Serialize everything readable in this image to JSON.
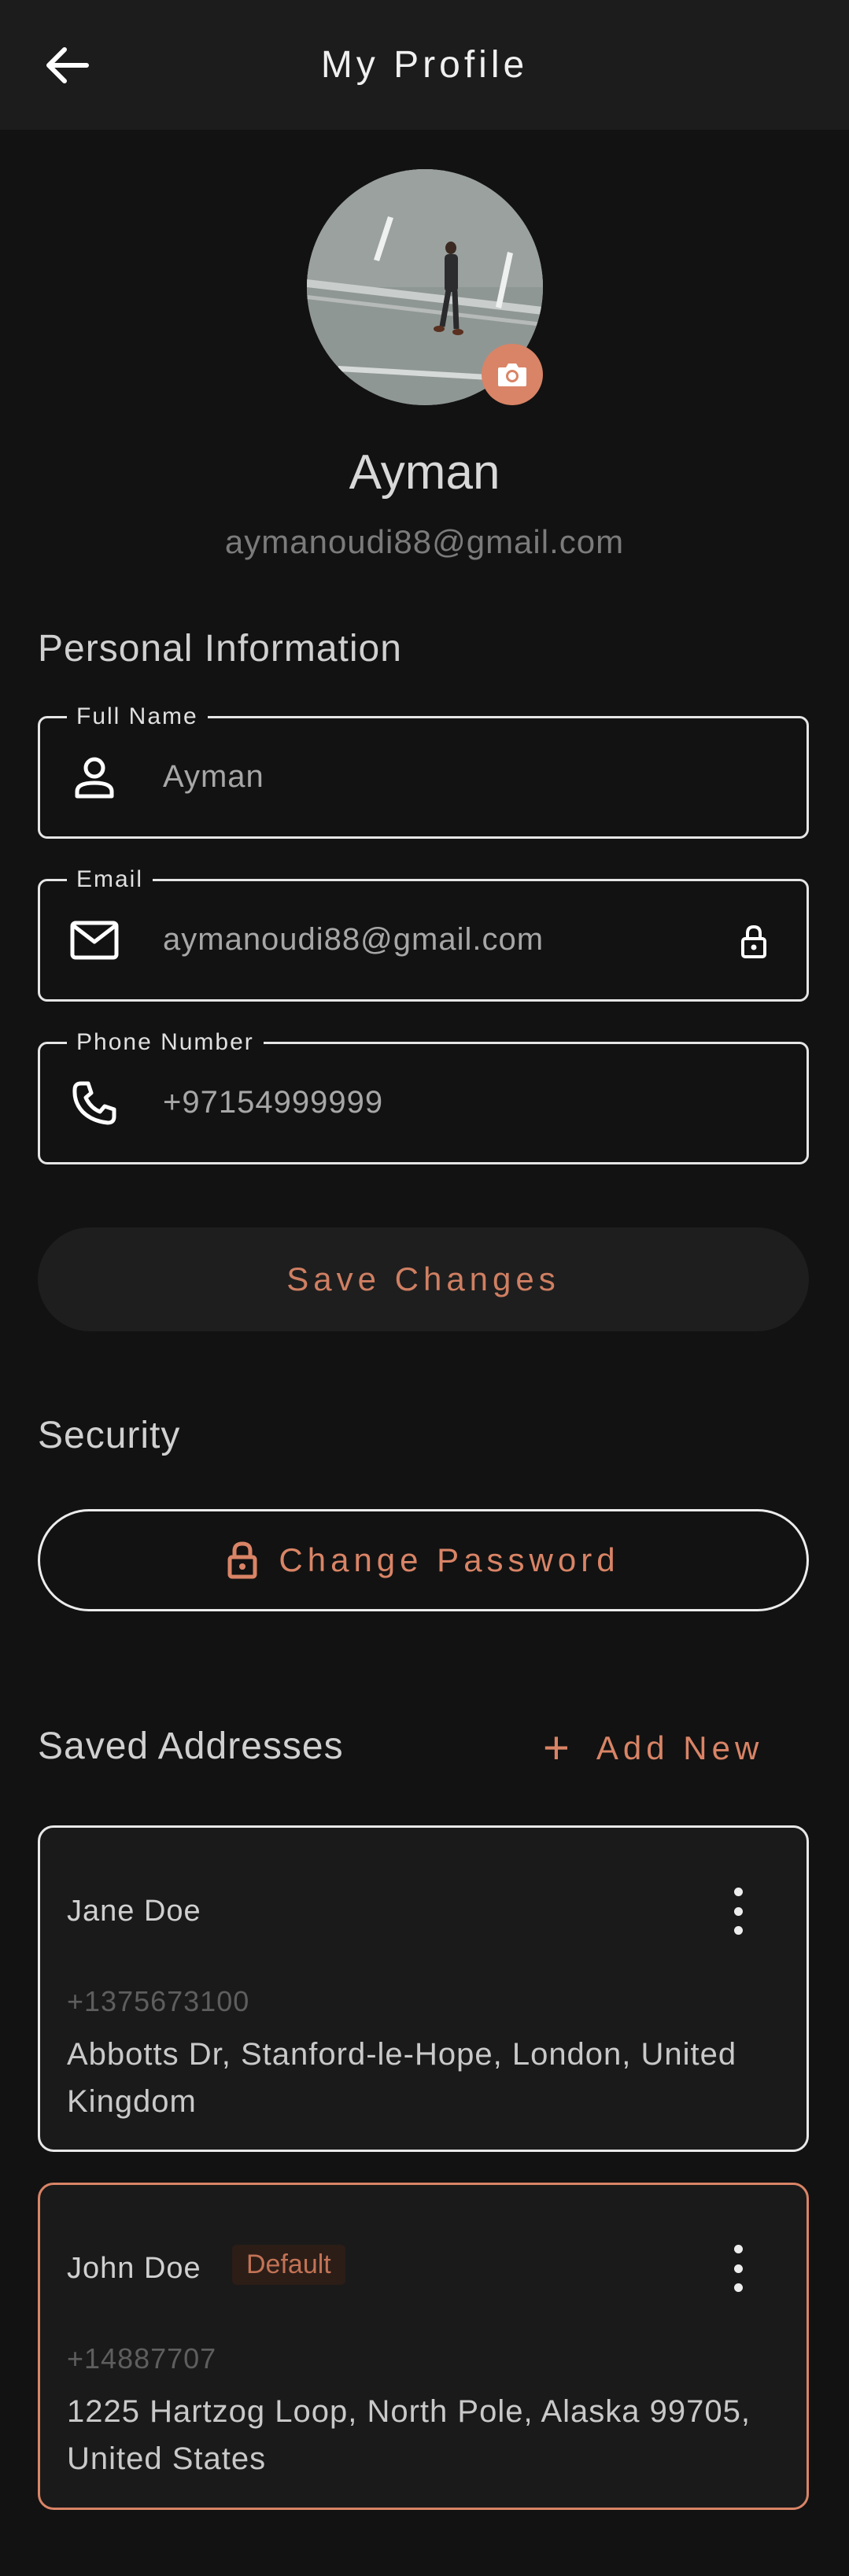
{
  "header": {
    "title": "My Profile"
  },
  "profile": {
    "name": "Ayman",
    "email": "aymanoudi88@gmail.com"
  },
  "personal": {
    "title": "Personal Information",
    "fields": [
      {
        "label": "Full Name",
        "value": "Ayman",
        "icon": "person-icon"
      },
      {
        "label": "Email",
        "value": "aymanoudi88@gmail.com",
        "icon": "mail-icon",
        "locked": true
      },
      {
        "label": "Phone Number",
        "value": "+97154999999",
        "icon": "phone-icon"
      }
    ],
    "save_label": "Save Changes"
  },
  "security": {
    "title": "Security",
    "change_password_label": "Change Password"
  },
  "addresses": {
    "title": "Saved Addresses",
    "add_new_label": "Add New",
    "items": [
      {
        "name": "Jane Doe",
        "phone": "+1375673100",
        "address": "Abbotts Dr, Stanford-le-Hope, London, United Kingdom",
        "is_default": false
      },
      {
        "name": "John Doe",
        "badge": "Default",
        "phone": "+14887707",
        "address": "1225 Hartzog Loop, North Pole, Alaska 99705, United States",
        "is_default": true
      }
    ]
  },
  "colors": {
    "accent": "#d98466",
    "background": "#121212",
    "surface": "#1c1c1c"
  }
}
